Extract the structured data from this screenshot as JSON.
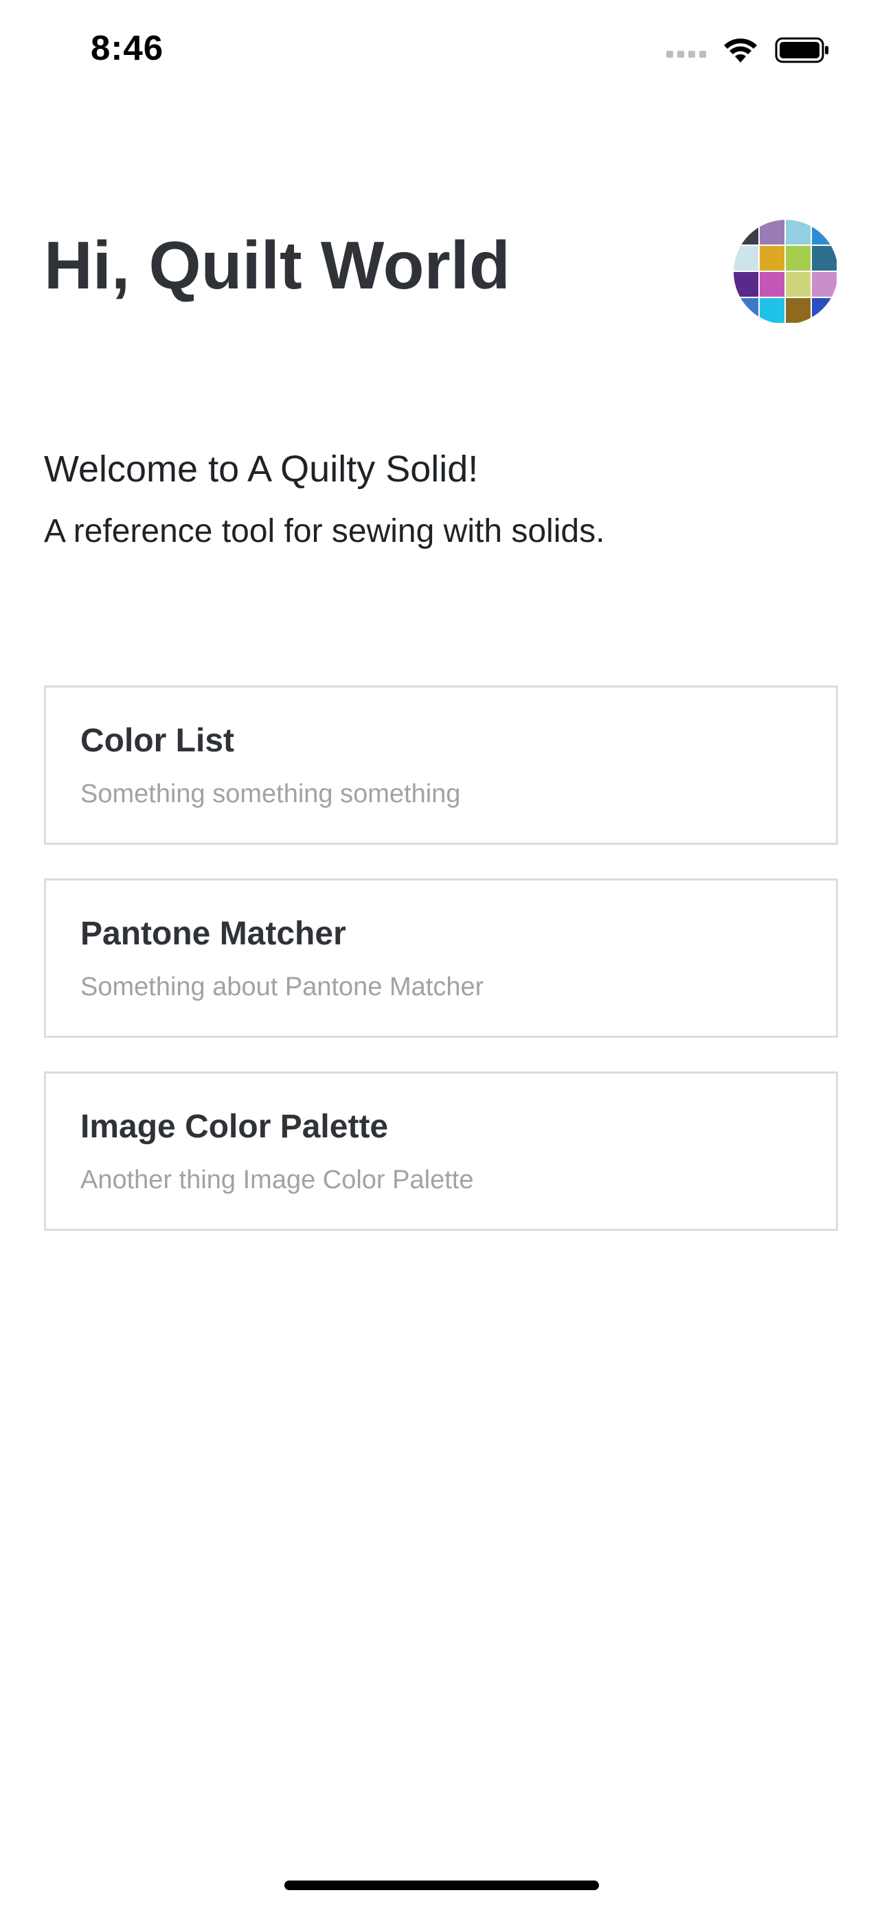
{
  "status_bar": {
    "time": "8:46"
  },
  "header": {
    "greeting": "Hi, Quilt World"
  },
  "intro": {
    "welcome": "Welcome to A Quilty Solid!",
    "tagline": "A reference tool for sewing with solids."
  },
  "cards": [
    {
      "title": "Color List",
      "subtitle": "Something something something"
    },
    {
      "title": "Pantone Matcher",
      "subtitle": "Something about Pantone Matcher"
    },
    {
      "title": "Image Color Palette",
      "subtitle": "Another thing Image Color Palette"
    }
  ],
  "avatar_swatch_colors": [
    "#3b3f47",
    "#9b7bb3",
    "#92cfe0",
    "#2c8ed2",
    "#cde4ea",
    "#dba923",
    "#a5ce4f",
    "#2e6f8e",
    "#5a2a8a",
    "#c456b8",
    "#cfd57a",
    "#c88fcb",
    "#3f78c7",
    "#21c2e8",
    "#8e6a1f",
    "#2a4fc1"
  ],
  "colors": {
    "text_dark": "#2f3338",
    "text_muted": "#a2a2a2",
    "card_border": "#dcdcdc"
  }
}
